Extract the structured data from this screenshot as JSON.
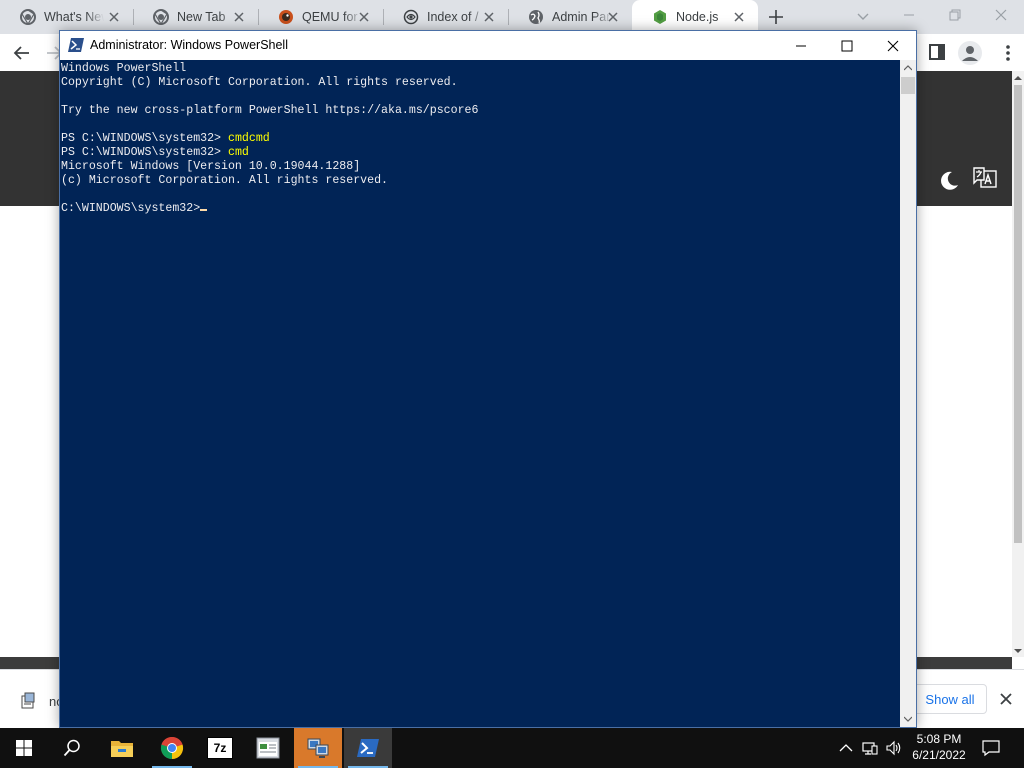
{
  "browser": {
    "tabs": [
      {
        "title": "What's New",
        "icon": "chrome-icon",
        "active": false
      },
      {
        "title": "New Tab",
        "icon": "chrome-icon",
        "active": false
      },
      {
        "title": "QEMU for Windows",
        "icon": "qemu-icon",
        "active": false
      },
      {
        "title": "Index of /",
        "icon": "index-icon",
        "active": false
      },
      {
        "title": "Admin Panel",
        "icon": "globe-icon",
        "active": false
      },
      {
        "title": "Node.js",
        "icon": "nodejs-icon",
        "active": true
      }
    ],
    "download_shelf": {
      "item_name": "no",
      "show_all_label": "Show all"
    }
  },
  "powershell": {
    "title": "Administrator: Windows PowerShell",
    "lines": [
      {
        "text": "Windows PowerShell"
      },
      {
        "text": "Copyright (C) Microsoft Corporation. All rights reserved."
      },
      {
        "text": ""
      },
      {
        "text": "Try the new cross-platform PowerShell https://aka.ms/pscore6"
      },
      {
        "text": ""
      },
      {
        "prompt": "PS C:\\WINDOWS\\system32> ",
        "command": "cmdcmd"
      },
      {
        "prompt": "PS C:\\WINDOWS\\system32> ",
        "command": "cmd"
      },
      {
        "text": "Microsoft Windows [Version 10.0.19044.1288]"
      },
      {
        "text": "(c) Microsoft Corporation. All rights reserved."
      },
      {
        "text": ""
      },
      {
        "prompt": "C:\\WINDOWS\\system32>",
        "cursor": true
      }
    ],
    "colors": {
      "background": "#012456",
      "text": "#eeedf0",
      "command": "#ffff00"
    }
  },
  "taskbar": {
    "apps": [
      "file-explorer-icon",
      "chrome-icon",
      "7zip-icon",
      "document-viewer-icon",
      "remote-desktop-icon",
      "powershell-icon"
    ],
    "seven_zip_label": "7z",
    "clock": {
      "time": "5:08 PM",
      "date": "6/21/2022"
    }
  }
}
